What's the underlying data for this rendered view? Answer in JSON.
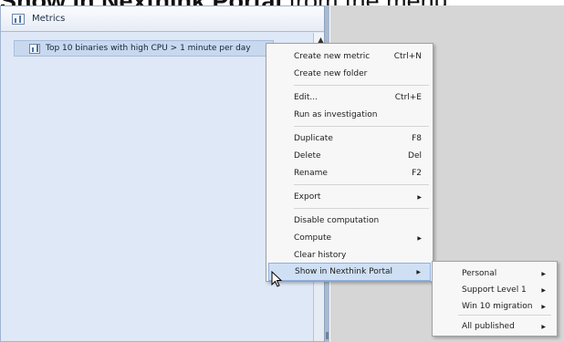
{
  "heading": {
    "bold_text": "Show in Nexthink Portal",
    "rest_text": " from the menu."
  },
  "panel": {
    "title": "Metrics",
    "icon": "metric-icon"
  },
  "tree": {
    "item_label": "Top 10 binaries with high CPU > 1 minute per day"
  },
  "context_menu": {
    "groups": [
      [
        {
          "label": "Create new metric",
          "shortcut": "Ctrl+N"
        },
        {
          "label": "Create new folder",
          "shortcut": ""
        }
      ],
      [
        {
          "label": "Edit...",
          "shortcut": "Ctrl+E"
        },
        {
          "label": "Run as investigation",
          "shortcut": ""
        }
      ],
      [
        {
          "label": "Duplicate",
          "shortcut": "F8"
        },
        {
          "label": "Delete",
          "shortcut": "Del"
        },
        {
          "label": "Rename",
          "shortcut": "F2"
        }
      ],
      [
        {
          "label": "Export",
          "shortcut": "",
          "submenu": true
        }
      ],
      [
        {
          "label": "Disable computation",
          "shortcut": ""
        },
        {
          "label": "Compute",
          "shortcut": "",
          "submenu": true
        },
        {
          "label": "Clear history",
          "shortcut": ""
        }
      ],
      [
        {
          "label": "Show in Nexthink Portal",
          "shortcut": "",
          "submenu": true,
          "highlighted": true
        }
      ]
    ]
  },
  "submenu": {
    "items": [
      {
        "label": "Personal"
      },
      {
        "label": "Support Level 1"
      },
      {
        "label": "Win 10 migration"
      },
      {
        "label": "All published"
      }
    ]
  },
  "colors": {
    "panel_bg": "#dfe8f6",
    "highlight": "#cfe0f5",
    "right_area": "#d6d6d6"
  }
}
